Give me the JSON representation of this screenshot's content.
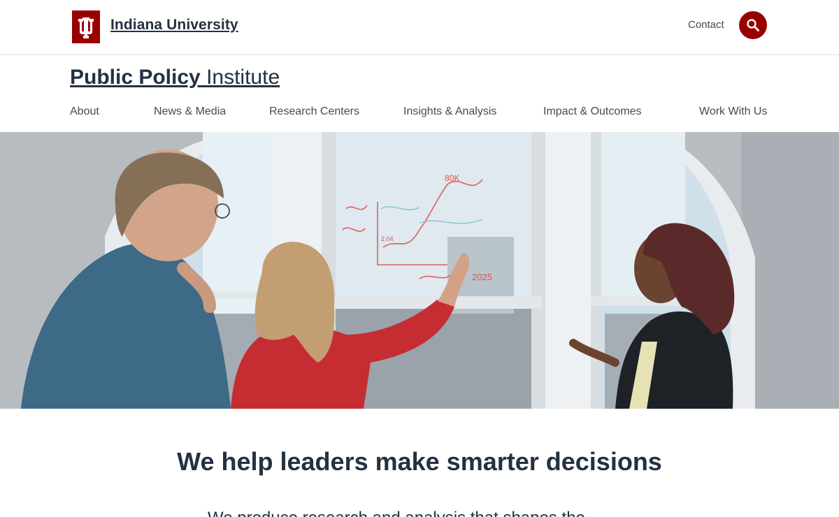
{
  "brand": {
    "university_name": "Indiana University",
    "logo_icon": "iu-trident-icon",
    "brand_color": "#990000",
    "text_color": "#243142"
  },
  "utility_nav": {
    "contact_label": "Contact",
    "search_icon": "search-icon"
  },
  "site": {
    "title_strong": "Public Policy",
    "title_light": "Institute"
  },
  "nav": {
    "items": [
      {
        "label": "About"
      },
      {
        "label": "News & Media"
      },
      {
        "label": "Research Centers"
      },
      {
        "label": "Insights & Analysis"
      },
      {
        "label": "Impact & Outcomes"
      },
      {
        "label": "Work With Us"
      }
    ]
  },
  "hero": {
    "whiteboard_text": [
      "80K",
      "2025",
      "2.04"
    ]
  },
  "intro": {
    "headline": "We help leaders make smarter decisions",
    "body": "We produce research and analysis that shapes the"
  }
}
